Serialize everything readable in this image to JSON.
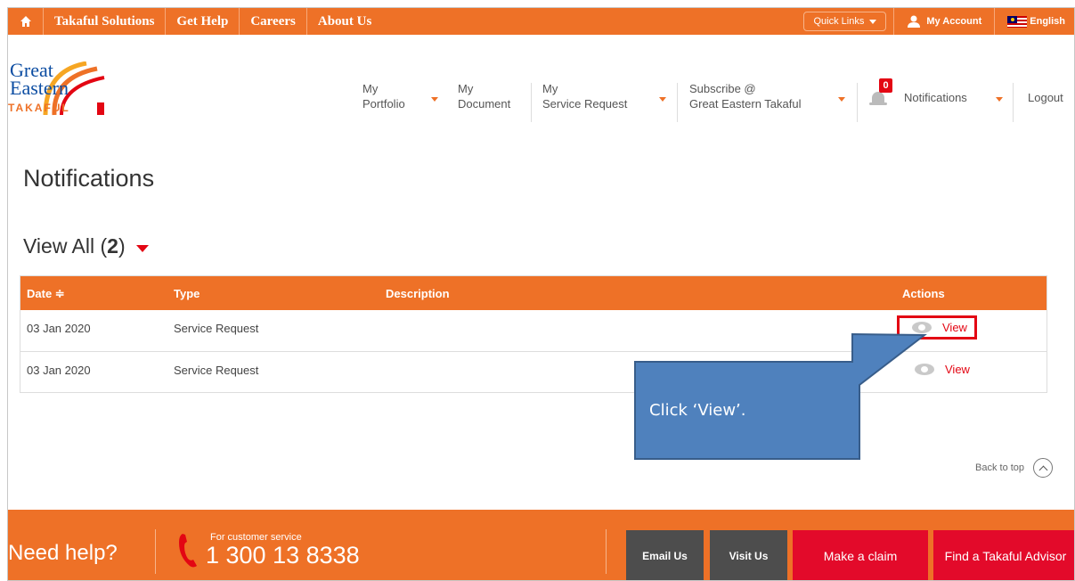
{
  "topbar": {
    "links": [
      "Takaful Solutions",
      "Get Help",
      "Careers",
      "About Us"
    ],
    "quick_links": "Quick Links",
    "my_account": "My Account",
    "language": "English"
  },
  "logo": {
    "line1": "Great",
    "line2": "Eastern",
    "line3": "TAKAFUL"
  },
  "nav": {
    "portfolio": [
      "My",
      "Portfolio"
    ],
    "document": [
      "My",
      "Document"
    ],
    "service": [
      "My",
      "Service Request"
    ],
    "subscribe": [
      "Subscribe @",
      "Great Eastern Takaful"
    ],
    "notifications": "Notifications",
    "notification_count": "0",
    "logout": "Logout"
  },
  "page": {
    "title": "Notifications",
    "view_all_label": "View All (",
    "view_all_count": "2",
    "view_all_close": ")"
  },
  "table": {
    "headers": {
      "date": "Date ≑",
      "type": "Type",
      "description": "Description",
      "actions": "Actions"
    },
    "rows": [
      {
        "date": "03 Jan 2020",
        "type": "Service Request",
        "description": "",
        "action": "View"
      },
      {
        "date": "03 Jan 2020",
        "type": "Service Request",
        "description": "",
        "action": "View"
      }
    ]
  },
  "callout": {
    "text": "Click ‘View’."
  },
  "back_to_top": "Back to top",
  "footer": {
    "need_help": "Need help?",
    "cs_label": "For customer service",
    "cs_number": "1 300 13 8338",
    "email_us": "Email Us",
    "visit_us": "Visit Us",
    "make_claim": "Make a claim",
    "find_advisor": "Find a Takaful Advisor"
  },
  "colors": {
    "brand_orange": "#ee7127",
    "accent_red": "#e30613",
    "brand_blue": "#0c4da2",
    "callout_blue": "#4f81bd"
  }
}
